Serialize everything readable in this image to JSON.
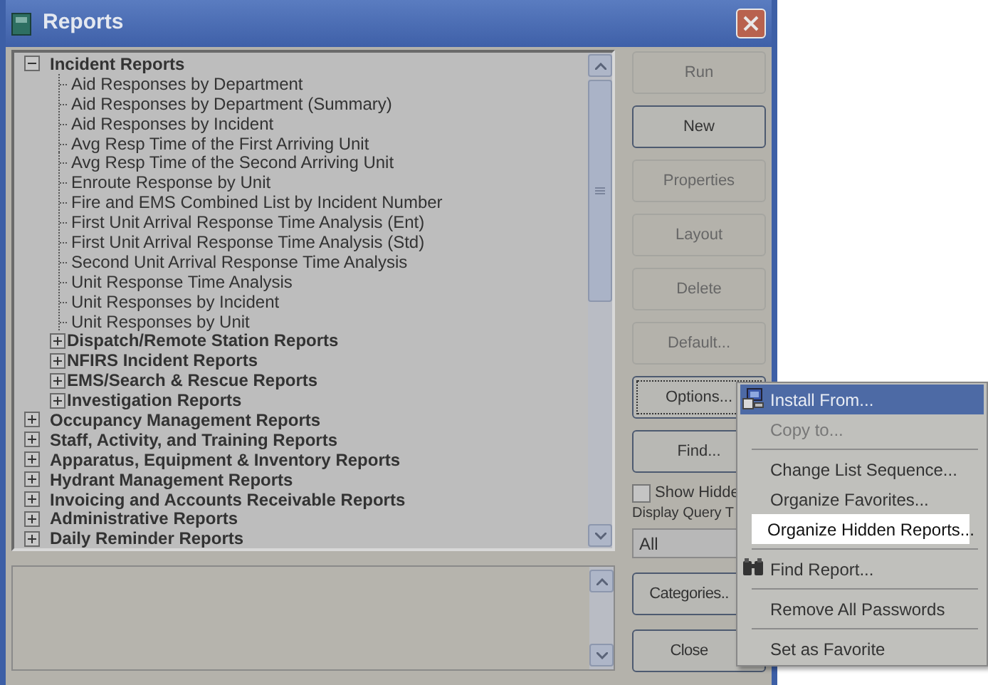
{
  "window": {
    "title": "Reports"
  },
  "report_tree": {
    "items": [
      {
        "label": "Incident Reports",
        "expanded": true,
        "children": [
          {
            "label": "Aid Responses by Department"
          },
          {
            "label": "Aid Responses by Department (Summary)"
          },
          {
            "label": "Aid Responses by Incident"
          },
          {
            "label": "Avg Resp Time of the First Arriving Unit"
          },
          {
            "label": "Avg Resp Time of the Second Arriving Unit"
          },
          {
            "label": "Enroute Response by Unit"
          },
          {
            "label": "Fire and EMS Combined List by Incident Number"
          },
          {
            "label": "First Unit Arrival Response Time Analysis (Ent)"
          },
          {
            "label": "First Unit Arrival Response Time Analysis (Std)"
          },
          {
            "label": "Second Unit Arrival Response Time Analysis"
          },
          {
            "label": "Unit Response Time Analysis"
          },
          {
            "label": "Unit Responses by Incident"
          },
          {
            "label": "Unit Responses by Unit"
          },
          {
            "label": "Dispatch/Remote Station Reports",
            "expanded": false
          },
          {
            "label": "NFIRS Incident Reports",
            "expanded": false
          },
          {
            "label": "EMS/Search & Rescue Reports",
            "expanded": false
          },
          {
            "label": "Investigation Reports",
            "expanded": false
          }
        ]
      },
      {
        "label": "Occupancy Management Reports",
        "expanded": false
      },
      {
        "label": "Staff, Activity, and Training Reports",
        "expanded": false
      },
      {
        "label": "Apparatus, Equipment & Inventory Reports",
        "expanded": false
      },
      {
        "label": "Hydrant Management Reports",
        "expanded": false
      },
      {
        "label": "Invoicing and Accounts Receivable Reports",
        "expanded": false
      },
      {
        "label": "Administrative Reports",
        "expanded": false
      },
      {
        "label": "Daily Reminder Reports",
        "expanded": false
      }
    ]
  },
  "buttons": [
    {
      "label": "Run",
      "disabled": true,
      "focused": false
    },
    {
      "label": "New",
      "disabled": false,
      "focused": false
    },
    {
      "label": "Properties",
      "disabled": true,
      "focused": false
    },
    {
      "label": "Layout",
      "disabled": true,
      "focused": false
    },
    {
      "label": "Delete",
      "disabled": true,
      "focused": false
    },
    {
      "label": "Default...",
      "disabled": true,
      "focused": false
    },
    {
      "label": "Options...",
      "disabled": false,
      "focused": true
    },
    {
      "label": "Find...",
      "disabled": false,
      "focused": false
    }
  ],
  "show_hidden": {
    "label": "Show Hidde",
    "checked": false
  },
  "display_query": {
    "label": "Display Query T",
    "value": "All"
  },
  "bottom_buttons": [
    {
      "label": "Categories..",
      "disabled": false
    },
    {
      "label": "Close",
      "disabled": false
    }
  ],
  "options_menu": {
    "items": [
      {
        "kind": "icon_item",
        "label": "Install From...",
        "selected": true,
        "disabled": false,
        "highlighted": false
      },
      {
        "kind": "item",
        "label": "Copy to...",
        "selected": false,
        "disabled": true,
        "highlighted": false
      },
      {
        "kind": "separator"
      },
      {
        "kind": "item",
        "label": "Change List Sequence...",
        "selected": false,
        "disabled": false,
        "highlighted": false
      },
      {
        "kind": "item",
        "label": "Organize Favorites...",
        "selected": false,
        "disabled": false,
        "highlighted": false
      },
      {
        "kind": "item",
        "label": "Organize Hidden Reports...",
        "selected": false,
        "disabled": false,
        "highlighted": true
      },
      {
        "kind": "separator"
      },
      {
        "kind": "icon_item",
        "label": "Find Report...",
        "selected": false,
        "disabled": false,
        "highlighted": false
      },
      {
        "kind": "separator"
      },
      {
        "kind": "item",
        "label": "Remove All Passwords",
        "selected": false,
        "disabled": false,
        "highlighted": false
      },
      {
        "kind": "separator"
      },
      {
        "kind": "item",
        "label": "Set as Favorite",
        "selected": false,
        "disabled": false,
        "highlighted": false
      }
    ]
  }
}
